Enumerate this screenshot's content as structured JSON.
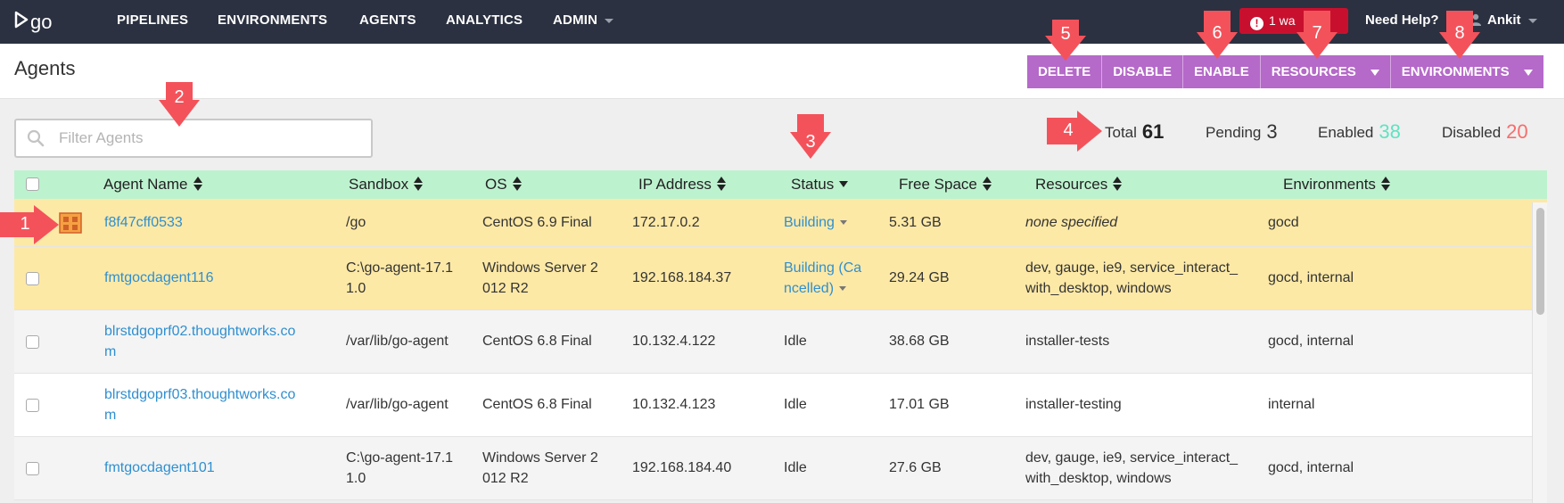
{
  "nav": {
    "logo_text": "go",
    "links": [
      "PIPELINES",
      "ENVIRONMENTS",
      "AGENTS",
      "ANALYTICS",
      "ADMIN"
    ],
    "warning": "1 wa",
    "need_help": "Need Help?",
    "user": "Ankit"
  },
  "page": {
    "title": "Agents",
    "buttons": {
      "delete": "DELETE",
      "disable": "DISABLE",
      "enable": "ENABLE",
      "resources": "RESOURCES",
      "environments": "ENVIRONMENTS"
    }
  },
  "filter": {
    "placeholder": "Filter Agents"
  },
  "counts": {
    "total_label": "Total",
    "total": "61",
    "pending_label": "Pending",
    "pending": "3",
    "enabled_label": "Enabled",
    "enabled": "38",
    "disabled_label": "Disabled",
    "disabled": "20"
  },
  "colors": {
    "nav_bg": "#2b3140",
    "button": "#b569c9",
    "header_row": "#bdf2cf",
    "building_row": "#fde9a6",
    "link": "#2f8fd0",
    "marker": "#f4525b"
  },
  "table": {
    "columns": [
      "Agent Name",
      "Sandbox",
      "OS",
      "IP Address",
      "Status",
      "Free Space",
      "Resources",
      "Environments"
    ],
    "rows": [
      {
        "name": "f8f47cff0533",
        "sandbox": "/go",
        "os": "CentOS 6.9 Final",
        "ip": "172.17.0.2",
        "status": "Building",
        "free": "5.31 GB",
        "resources": "none specified",
        "env": "gocd"
      },
      {
        "name": "fmtgocdagent116",
        "sandbox_1": "C:\\go-agent-17.1",
        "sandbox_2": "1.0",
        "os_1": "Windows Server 2",
        "os_2": "012 R2",
        "ip": "192.168.184.37",
        "status_1": "Building (Ca",
        "status_2": "ncelled)",
        "free": "29.24 GB",
        "res_1": "dev, gauge, ie9, service_interact_",
        "res_2": "with_desktop, windows",
        "env": "gocd, internal"
      },
      {
        "name_1": "blrstdgoprf02.thoughtworks.co",
        "name_2": "m",
        "sandbox": "/var/lib/go-agent",
        "os": "CentOS 6.8 Final",
        "ip": "10.132.4.122",
        "status": "Idle",
        "free": "38.68 GB",
        "resources": "installer-tests",
        "env": "gocd, internal"
      },
      {
        "name_1": "blrstdgoprf03.thoughtworks.co",
        "name_2": "m",
        "sandbox": "/var/lib/go-agent",
        "os": "CentOS 6.8 Final",
        "ip": "10.132.4.123",
        "status": "Idle",
        "free": "17.01 GB",
        "resources": "installer-testing",
        "env": "internal"
      },
      {
        "name": "fmtgocdagent101",
        "sandbox_1": "C:\\go-agent-17.1",
        "sandbox_2": "1.0",
        "os_1": "Windows Server 2",
        "os_2": "012 R2",
        "ip": "192.168.184.40",
        "status": "Idle",
        "free": "27.6 GB",
        "res_1": "dev, gauge, ie9, service_interact_",
        "res_2": "with_desktop, windows",
        "env": "gocd, internal"
      }
    ]
  },
  "markers": [
    "1",
    "2",
    "3",
    "4",
    "5",
    "6",
    "7",
    "8"
  ]
}
